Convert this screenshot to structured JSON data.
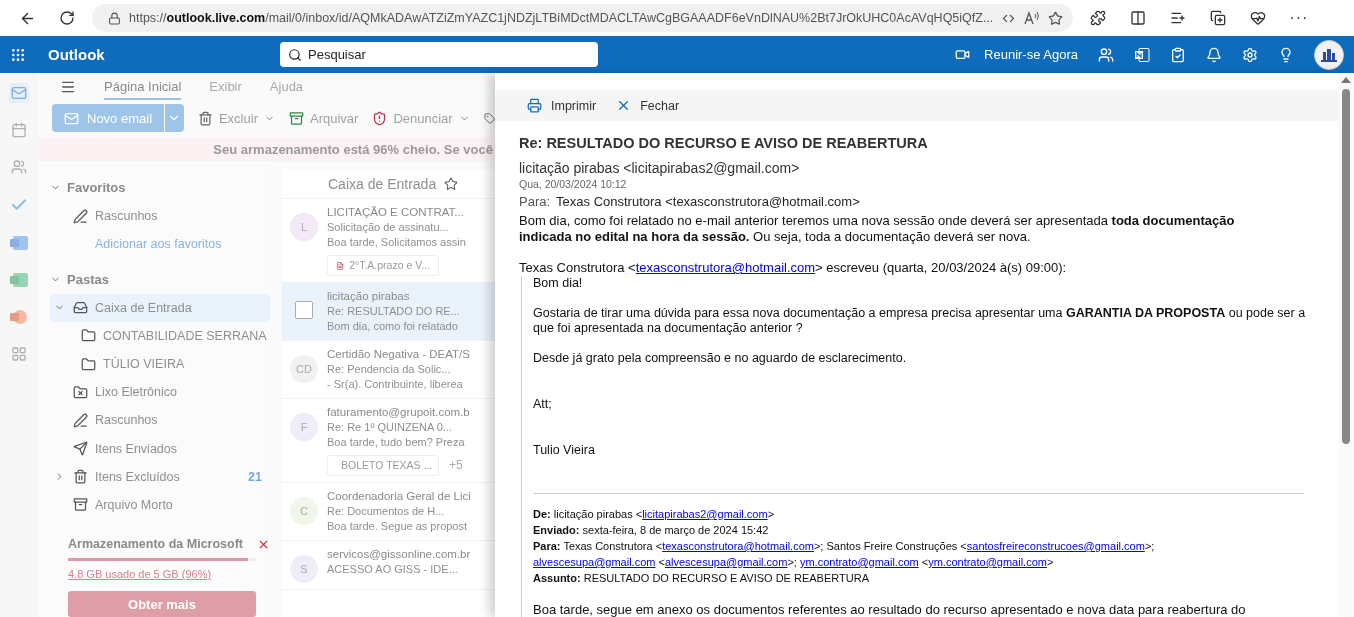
{
  "browser": {
    "url": "https://**outlook.live.com**/mail/0/inbox/id/AQMkADAwATZiZmYAZC1jNDZjLTBiMDctMDACLTAwCgBGAAADF6eVnDlNAU%2Bt7JrOkUHC0AcAVqHQ5iQfZ...",
    "more": "···"
  },
  "header": {
    "app": "Outlook",
    "search": {
      "placeholder": "Pesquisar"
    },
    "meet": "Reunir-se Agora"
  },
  "rail": [
    {
      "kind": "mail",
      "selected": true
    },
    {
      "kind": "calendar",
      "selected": false
    },
    {
      "kind": "people",
      "selected": false
    },
    {
      "kind": "todo",
      "selected": false
    },
    {
      "kind": "word",
      "selected": false
    },
    {
      "kind": "excel",
      "selected": false
    },
    {
      "kind": "powerpoint",
      "selected": false
    },
    {
      "kind": "apps",
      "selected": false
    }
  ],
  "ribbon": {
    "tabs": [
      {
        "label": "Página Inicial",
        "selected": true
      },
      {
        "label": "Exibir",
        "selected": false
      },
      {
        "label": "Ajuda",
        "selected": false
      }
    ],
    "actions": [
      {
        "kind": "new",
        "label": "Novo email"
      },
      {
        "kind": "delete",
        "label": "Excluir"
      },
      {
        "kind": "archive",
        "label": "Arquivar"
      },
      {
        "kind": "report",
        "label": "Denunciar"
      }
    ]
  },
  "banner": "Seu armazenamento está 96% cheio. Se você",
  "folders": {
    "sections": [
      {
        "title": "Favoritos",
        "expanded": true,
        "items": [
          {
            "kind": "drafts",
            "label": "Rascunhos",
            "selected": false
          },
          {
            "kind": "add",
            "label": "Adicionar aos favoritos",
            "selected": false
          }
        ]
      },
      {
        "title": "Pastas",
        "expanded": true,
        "items": [
          {
            "kind": "inbox",
            "label": "Caixa de Entrada",
            "selected": true,
            "expanded": true,
            "children": [
              {
                "kind": "folder",
                "label": "CONTABILIDADE SERRANA",
                "selected": false
              },
              {
                "kind": "folder",
                "label": "TÚLIO VIEIRA",
                "selected": false
              }
            ]
          },
          {
            "kind": "junk",
            "label": "Lixo Eletrônico",
            "selected": false
          },
          {
            "kind": "drafts",
            "label": "Rascunhos",
            "selected": false
          },
          {
            "kind": "sent",
            "label": "Itens Enviados",
            "selected": false
          },
          {
            "kind": "deleted",
            "label": "Itens Excluídos",
            "selected": false,
            "expanded": false,
            "count": "21"
          },
          {
            "kind": "archive",
            "label": "Arquivo Morto",
            "selected": false
          }
        ]
      }
    ]
  },
  "storage": {
    "title": "Armazenamento da Microsoft",
    "level": 0.96,
    "usage": "4.8 GB usado de 5 GB (96%)",
    "button": "Obter mais"
  },
  "message_list": {
    "title": "Caixa de Entrada",
    "messages": [
      {
        "initials": "L",
        "color": "#f4eaf7",
        "sender": "LICITAÇÃO E CONTRAT...",
        "subject": "Solicitação de assinatu...",
        "preview": "Boa tarde, Solicitamos assin",
        "attachment": "2°T.A.prazo e V...",
        "selected": false
      },
      {
        "sender": "licitação pirabas",
        "subject": "Re: RESULTADO DO RE...",
        "preview": "Bom dia, como foi relatado",
        "selected": true
      },
      {
        "initials": "CD",
        "color": "#f1f1f1",
        "sender": "Certidão Negativa - DEAT/S",
        "subject": "Re: Pendencia da Solic...",
        "preview": "- Sr(a). Contribuinte, liberea",
        "selected": false
      },
      {
        "initials": "F",
        "color": "#eeeefb",
        "sender": "faturamento@grupoit.com.b",
        "subject": "Re: Re 1º QUINZENA 0...",
        "preview": "Boa tarde, tudo bem? Preza",
        "attachment": "BOLETO TEXAS ...",
        "more": "+5",
        "selected": false
      },
      {
        "initials": "C",
        "color": "#eff7e9",
        "sender": "Coordenadoria Geral de Lici",
        "subject": "Re: Documentos de H...",
        "preview": "Boa tarde. Segue as propost",
        "selected": false
      },
      {
        "initials": "S",
        "color": "#eeeefb",
        "sender": "servicos@gissonline.com.br",
        "subject": "ACESSO AO GISS - IDE...",
        "selected": false
      }
    ]
  },
  "reading": {
    "actions": [
      {
        "kind": "print",
        "label": "Imprimir"
      },
      {
        "kind": "close",
        "label": "Fechar"
      }
    ],
    "subject": "Re: RESULTADO DO RECURSO E AVISO DE REABERTURA",
    "from": "licitação pirabas <licitapirabas2@gmail.com>",
    "date": "Qua, 20/03/2024 10:12",
    "to_label": "Para:",
    "to": "Texas Construtora <texasconstrutora@hotmail.com>",
    "body": "Bom dia, como foi relatado no e-mail anterior  teremos uma nova sessão onde deverá ser apresentada **toda documentação indicada no edital na hora da sessão.** Ou seja, toda a documentação deverá ser nova.",
    "quote_header": [
      {
        "kind": "text",
        "text": "Texas Construtora <"
      },
      {
        "kind": "link",
        "text": "texasconstrutora@hotmail.com"
      },
      {
        "kind": "text",
        "text": "> escreveu (quarta, 20/03/2024 à(s) 09:00):"
      }
    ],
    "quote": [
      {
        "kind": "text",
        "text": "Bom dia!"
      },
      {
        "kind": "text",
        "text": "Gostaria de tirar uma dúvida para essa nova documentação a empresa precisa apresentar uma **GARANTIA DA PROPOSTA** ou pode ser a que foi apresentada na documentação anterior ?"
      },
      {
        "kind": "text",
        "text": "Desde já grato pela compreensão e no aguardo de esclarecimento."
      },
      {
        "kind": "signature",
        "text": "Att;"
      },
      {
        "kind": "signature",
        "text": "Tulio Vieira"
      }
    ],
    "forwarded": [
      [
        {
          "kind": "bold",
          "text": "De:"
        },
        {
          "kind": "text",
          "text": " licitação pirabas <"
        },
        {
          "kind": "link",
          "text": "licitapirabas2@gmail.com"
        },
        {
          "kind": "text",
          "text": ">"
        }
      ],
      [
        {
          "kind": "bold",
          "text": "Enviado:"
        },
        {
          "kind": "text",
          "text": " sexta-feira, 8 de março de 2024 15:42"
        }
      ],
      [
        {
          "kind": "bold",
          "text": "Para:"
        },
        {
          "kind": "text",
          "text": " Texas Construtora <"
        },
        {
          "kind": "link",
          "text": "texasconstrutora@hotmail.com"
        },
        {
          "kind": "text",
          "text": ">; Santos Freire Construções <"
        },
        {
          "kind": "link",
          "text": "santosfreireconstrucoes@gmail.com"
        },
        {
          "kind": "text",
          "text": ">;"
        }
      ],
      [
        {
          "kind": "link",
          "text": "alvescesupa@gmail.com"
        },
        {
          "kind": "text",
          "text": " <"
        },
        {
          "kind": "link",
          "text": "alvescesupa@gmail.com"
        },
        {
          "kind": "text",
          "text": ">; "
        },
        {
          "kind": "link",
          "text": "ym.contrato@gmail.com"
        },
        {
          "kind": "text",
          "text": " <"
        },
        {
          "kind": "link",
          "text": "ym.contrato@gmail.com"
        },
        {
          "kind": "text",
          "text": ">"
        }
      ],
      [
        {
          "kind": "bold",
          "text": "Assunto:"
        },
        {
          "kind": "text",
          "text": " RESULTADO DO RECURSO E AVISO DE REABERTURA"
        }
      ]
    ],
    "last_paragraph": "Boa tarde, segue em anexo os documentos referentes ao resultado do recurso apresentado e nova data para reabertura do"
  }
}
